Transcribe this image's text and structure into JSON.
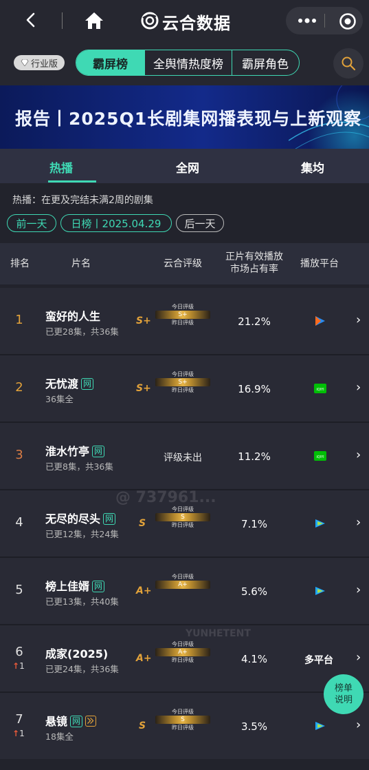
{
  "header": {
    "app_title": "云合数据"
  },
  "nav": {
    "industry_badge": "行业版",
    "segments": [
      "霸屏榜",
      "全舆情热度榜",
      "霸屏角色"
    ]
  },
  "banner": {
    "title": "报告丨2025Q1长剧集网播表现与上新观察"
  },
  "tabs": [
    "热播",
    "全网",
    "集均"
  ],
  "filter": {
    "description": "热播：在更及完结未满2周的剧集",
    "prev_day": "前一天",
    "date_label": "日榜丨2025.04.29",
    "next_day": "后一天"
  },
  "table": {
    "headers": {
      "rank": "排名",
      "title": "片名",
      "rating": "云合评级",
      "share_line1": "正片有效播放",
      "share_line2": "市场占有率",
      "platform": "播放平台"
    },
    "rows": [
      {
        "rank": "1",
        "name": "蛮好的人生",
        "web": "",
        "sub": "已更28集，共36集",
        "grade": "S+",
        "today_label": "今日评级",
        "today": "S+",
        "yesterday_label": "昨日评级",
        "share": "21.2%",
        "platform": "youku-icon",
        "rank_change": ""
      },
      {
        "rank": "2",
        "name": "无忧渡",
        "web": "网",
        "sub": "36集全",
        "grade": "S+",
        "today_label": "今日评级",
        "today": "S+",
        "yesterday_label": "昨日评级",
        "share": "16.9%",
        "platform": "iqiyi-icon",
        "rank_change": ""
      },
      {
        "rank": "3",
        "name": "淮水竹亭",
        "web": "网",
        "sub": "已更8集，共36集",
        "grade": "",
        "no_grade": "评级未出",
        "share": "11.2%",
        "platform": "iqiyi-icon",
        "rank_change": ""
      },
      {
        "rank": "4",
        "name": "无尽的尽头",
        "web": "网",
        "sub": "已更12集，共24集",
        "grade": "S",
        "today_label": "今日评级",
        "today": "S",
        "yesterday_label": "昨日评级",
        "share": "7.1%",
        "platform": "tencent-video-icon",
        "rank_change": ""
      },
      {
        "rank": "5",
        "name": "榜上佳婿",
        "web": "网",
        "sub": "已更13集，共40集",
        "grade": "A+",
        "today_label": "今日评级",
        "today": "A+",
        "yesterday_label": "",
        "share": "5.6%",
        "platform": "tencent-video-icon",
        "rank_change": ""
      },
      {
        "rank": "6",
        "name": "成家(2025)",
        "web": "",
        "sub": "已更24集，共36集",
        "grade": "A+",
        "today_label": "今日评级",
        "today": "A+",
        "yesterday_label": "昨日评级",
        "share": "4.1%",
        "platform_text": "多平台",
        "rank_change": "1"
      },
      {
        "rank": "7",
        "name": "悬镜",
        "web": "网",
        "sub": "18集全",
        "grade": "S",
        "today_label": "今日评级",
        "today": "S",
        "yesterday_label": "昨日评级",
        "share": "3.5%",
        "platform": "tencent-video-icon",
        "rank_change": "1"
      }
    ]
  },
  "fab": {
    "line1": "榜单",
    "line2": "说明"
  },
  "watermarks": {
    "number": "@ 737961...",
    "brand_en": "YUNHETENT"
  },
  "colors": {
    "accent": "#3fd9b4",
    "grade_gold": "#e2a23a",
    "background": "#22232c"
  }
}
